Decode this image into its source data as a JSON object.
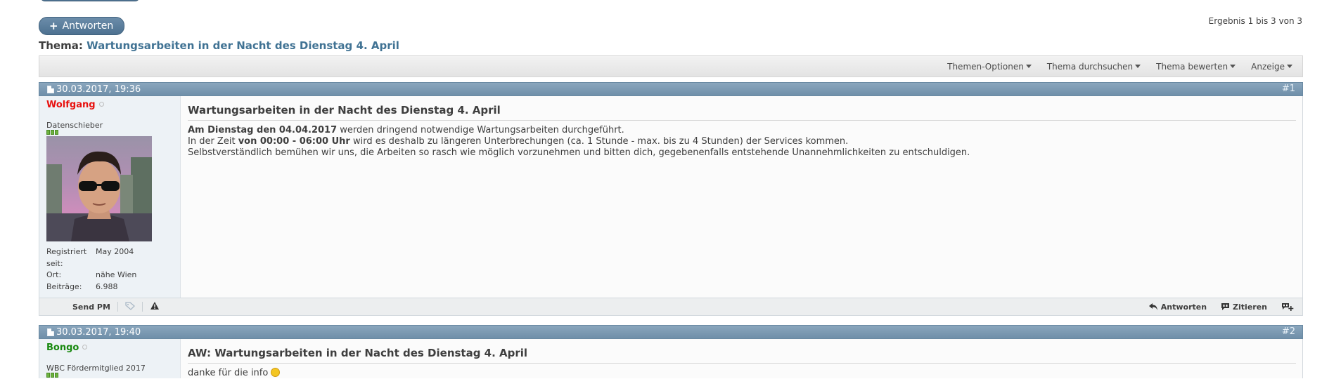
{
  "toolbar": {
    "reply_label": "Antworten",
    "result_text": "Ergebnis 1 bis 3 von 3"
  },
  "thread": {
    "prefix": "Thema:",
    "title": "Wartungsarbeiten in der Nacht des Dienstag 4. April"
  },
  "thread_tools": [
    {
      "label": "Themen-Optionen"
    },
    {
      "label": "Thema durchsuchen"
    },
    {
      "label": "Thema bewerten"
    },
    {
      "label": "Anzeige"
    }
  ],
  "posts": [
    {
      "date": "30.03.2017, 19:36",
      "number": "#1",
      "username": "Wolfgang",
      "username_color": "#e8110f",
      "usertitle": "Datenschieber",
      "stats": [
        {
          "label": "Registriert seit:",
          "value": "May 2004"
        },
        {
          "label": "Ort:",
          "value": "nähe Wien"
        },
        {
          "label": "Beiträge:",
          "value": "6.988"
        }
      ],
      "title": "Wartungsarbeiten in der Nacht des Dienstag 4. April",
      "line1_bold": "Am Dienstag den 04.04.2017",
      "line1_rest": " werden dringend notwendige Wartungsarbeiten durchgeführt.",
      "line2_pre": "In der Zeit ",
      "line2_bold": "von 00:00 - 06:00 Uhr",
      "line2_rest": " wird es deshalb zu längeren Unterbrechungen (ca. 1 Stunde - max. bis zu 4 Stunden) der Services kommen.",
      "line3": "Selbstverständlich bemühen wir uns, die Arbeiten so rasch wie möglich vorzunehmen und bitten dich, gegebenenfalls entstehende Unannehmlichkeiten zu entschuldigen.",
      "footer": {
        "send_pm": "Send PM",
        "reply": "Antworten",
        "quote": "Zitieren"
      }
    },
    {
      "date": "30.03.2017, 19:40",
      "number": "#2",
      "username": "Bongo",
      "username_color": "#18890f",
      "usertitle": "WBC Fördermitglied 2017",
      "title": "AW: Wartungsarbeiten in der Nacht des Dienstag 4. April",
      "text": "danke für die info"
    }
  ]
}
